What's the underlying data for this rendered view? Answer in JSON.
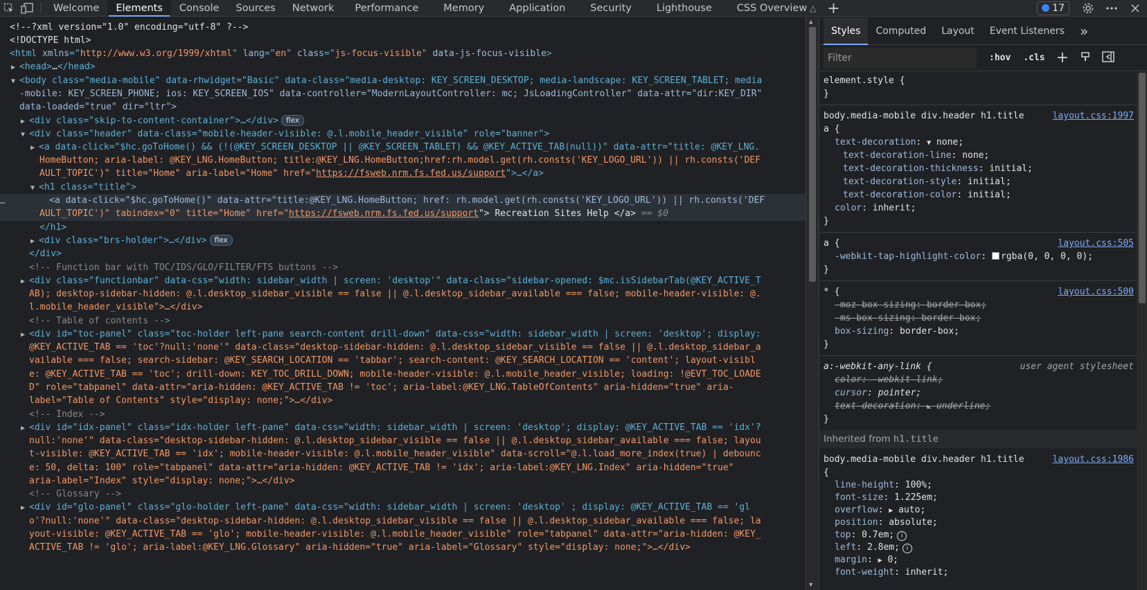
{
  "toolbar": {
    "inspect_icon": "inspect-element-icon",
    "device_icon": "device-toolbar-icon",
    "tabs": [
      "Welcome",
      "Elements",
      "Console",
      "Sources",
      "Network",
      "Performance",
      "Memory",
      "Application",
      "Security",
      "Lighthouse",
      "CSS Overview"
    ],
    "active_tab": "Elements",
    "issues_count": "17",
    "add_tab": "+"
  },
  "dom": {
    "l1": "<!--?xml version=\"1.0\" encoding=\"utf-8\" ?-->",
    "l2": "<!DOCTYPE html>",
    "l3_a": "<html ",
    "l3_b": "xmlns",
    "l3_c": "=\"",
    "l3_d": "http://www.w3.org/1999/xhtml",
    "l3_e": "\" ",
    "l3_f": "lang",
    "l3_g": "en",
    "l3_h": "class",
    "l3_i": "js-focus-visible",
    "l3_j": "data-js-focus-visible",
    "l4_tag": "<head>",
    "l4_dots": "…",
    "l4_end": "</head>",
    "lines": [
      "<body class=\"media-mobile\" data-rhwidget=\"Basic\" data-class=\"media-desktop: KEY_SCREEN_DESKTOP; media-landscape: KEY_SCREEN_TABLET; media",
      "-mobile: KEY_SCREEN_PHONE; ios: KEY_SCREEN_IOS\" data-controller=\"ModernLayoutController: mc; JsLoadingController\" data-attr=\"dir:KEY_DIR\"",
      "data-loaded=\"true\" dir=\"ltr\">",
      "<div class=\"skip-to-content-container\">…</div>",
      "<div class=\"header\" data-class=\"mobile-header-visible: @.l.mobile_header_visible\" role=\"banner\">",
      "<a data-click=\"$hc.goToHome() && (!(@KEY_SCREEN_DESKTOP || @KEY_SCREEN_TABLET) && @KEY_ACTIVE_TAB(null))\" data-attr=\"title: @KEY_LNG.",
      "HomeButton; aria-label: @KEY_LNG.HomeButton; title:@KEY_LNG.HomeButton;href:rh.model.get(rh.consts('KEY_LOGO_URL')) || rh.consts('DEF",
      "AULT_TOPIC')\" title=\"Home\" aria-label=\"Home\" href=\"",
      "<h1 class=\"title\">",
      "<a data-click=\"$hc.goToHome()\" data-attr=\"title:@KEY_LNG.HomeButton; href: rh.model.get(rh.consts('KEY_LOGO_URL')) || rh.consts('DEF",
      "AULT_TOPIC')\" tabindex=\"0\" title=\"Home\" href=\"",
      "</h1>",
      "<div class=\"brs-holder\">…</div>",
      "</div>",
      "<!-- Function bar with TOC/IDS/GLO/FILTER/FTS buttons -->",
      "<div class=\"functionbar\" data-css=\"width: sidebar_width | screen: 'desktop'\" data-class=\"sidebar-opened: $mc.isSidebarTab(@KEY_ACTIVE_T",
      "AB); desktop-sidebar-hidden: @.l.desktop_sidebar_visible == false || @.l.desktop_sidebar_available === false; mobile-header-visible: @.",
      "l.mobile_header_visible\">…</div>",
      "<!-- Table of contents -->",
      "<div id=\"toc-panel\" class=\"toc-holder left-pane search-content drill-down\" data-css=\"width: sidebar_width | screen: 'desktop'; display:",
      "@KEY_ACTIVE_TAB == 'toc'?null:'none'\" data-class=\"desktop-sidebar-hidden: @.l.desktop_sidebar_visible == false || @.l.desktop_sidebar_a",
      "vailable === false; search-sidebar: @KEY_SEARCH_LOCATION == 'tabbar'; search-content: @KEY_SEARCH_LOCATION == 'content'; layout-visibl",
      "e: @KEY_ACTIVE_TAB == 'toc'; drill-down: KEY_TOC_DRILL_DOWN; mobile-header-visible: @.l.mobile_header_visible; loading: !@EVT_TOC_LOADE",
      "D\" role=\"tabpanel\" data-attr=\"aria-hidden: @KEY_ACTIVE_TAB != 'toc'; aria-label:@KEY_LNG.TableOfContents\" aria-hidden=\"true\" aria-",
      "label=\"Table of Contents\" style=\"display: none;\">…</div>",
      "<!-- Index -->",
      "<div id=\"idx-panel\" class=\"idx-holder left-pane\" data-css=\"width: sidebar_width | screen: 'desktop'; display: @KEY_ACTIVE_TAB == 'idx'?",
      "null:'none'\" data-class=\"desktop-sidebar-hidden: @.l.desktop_sidebar_visible == false || @.l.desktop_sidebar_available === false; layou",
      "t-visible: @KEY_ACTIVE_TAB == 'idx'; mobile-header-visible: @.l.mobile_header_visible\" data-scroll=\"@.l.load_more_index(true) | debounc",
      "e: 50, delta: 100\" role=\"tabpanel\" data-attr=\"aria-hidden: @KEY_ACTIVE_TAB != 'idx'; aria-label:@KEY_LNG.Index\" aria-hidden=\"true\"",
      "aria-label=\"Index\" style=\"display: none;\">…</div>",
      "<!-- Glossary -->",
      "<div id=\"glo-panel\" class=\"glo-holder left-pane\" data-css=\"width: sidebar_width | screen: 'desktop' ; display: @KEY_ACTIVE_TAB == 'gl",
      "o'?null:'none'\" data-class=\"desktop-sidebar-hidden: @.l.desktop_sidebar_visible == false || @.l.desktop_sidebar_available === false; la",
      "yout-visible: @KEY_ACTIVE_TAB == 'glo'; mobile-header-visible: @.l.mobile_header_visible\" role=\"tabpanel\" data-attr=\"aria-hidden: @KEY_",
      "ACTIVE_TAB != 'glo'; aria-label:@KEY_LNG.Glossary\" aria-hidden=\"true\" aria-label=\"Glossary\" style=\"display: none;\">…</div>"
    ],
    "link_url": "https://fsweb.nrm.fs.fed.us/support",
    "link_tail_1": "\">…</a>",
    "link_tail_2": "\"> Recreation Sites Help </a>",
    "dollar0": "== $0",
    "flex_badge": "flex",
    "gutter_dots": "…"
  },
  "styles": {
    "tabs": [
      "Styles",
      "Computed",
      "Layout",
      "Event Listeners"
    ],
    "more_tabs": "»",
    "filter_placeholder": "Filter",
    "hov": ":hov",
    "cls": ".cls",
    "element_style": "element.style {",
    "close_brace": "}",
    "r1_sel": "body.media-mobile div.header h1.title",
    "r1_sel2": "a {",
    "r1_src": "layout.css:1997",
    "r1_p1": "text-decoration",
    "r1_v1": "none;",
    "r1_p2": "text-decoration-line",
    "r1_v2": "none;",
    "r1_p3": "text-decoration-thickness",
    "r1_v3": "initial;",
    "r1_p4": "text-decoration-style",
    "r1_v4": "initial;",
    "r1_p5": "text-decoration-color",
    "r1_v5": "initial;",
    "r1_p6": "color",
    "r1_v6": "inherit;",
    "r2_sel": "a {",
    "r2_src": "layout.css:505",
    "r2_p1": "-webkit-tap-highlight-color",
    "r2_v1": "rgba(0, 0, 0, 0);",
    "r3_sel": "* {",
    "r3_src": "layout.css:500",
    "r3_p1": "-moz-box-sizing",
    "r3_v1": "border-box;",
    "r3_p2": "-ms-box-sizing",
    "r3_v2": "border-box;",
    "r3_p3": "box-sizing",
    "r3_v3": "border-box;",
    "r4_sel": "a:-webkit-any-link {",
    "r4_src": "user agent stylesheet",
    "r4_p1": "color",
    "r4_v1": "-webkit-link;",
    "r4_p2": "cursor",
    "r4_v2": "pointer;",
    "r4_p3": "text-decoration",
    "r4_v3": "underline;",
    "inherited_label": "Inherited from",
    "inherited_el": "h1.title",
    "r5_sel": "body.media-mobile div.header h1.title",
    "r5_sel2": "{",
    "r5_src": "layout.css:1986",
    "r5_p1": "line-height",
    "r5_v1": "100%;",
    "r5_p2": "font-size",
    "r5_v2": "1.225em;",
    "r5_p3": "overflow",
    "r5_v3": "auto;",
    "r5_p4": "position",
    "r5_v4": "absolute;",
    "r5_p5": "top",
    "r5_v5": "0.7em;",
    "r5_p6": "left",
    "r5_v6": "2.8em;",
    "r5_p7": "margin",
    "r5_v7": "0;",
    "r5_p8": "font-weight",
    "r5_v8": "inherit;"
  },
  "colors": {
    "accent": "#7cacf8",
    "tag": "#5db0d7",
    "attr_name": "#9bbbdc",
    "attr_value": "#f29766",
    "comment": "#898989"
  }
}
